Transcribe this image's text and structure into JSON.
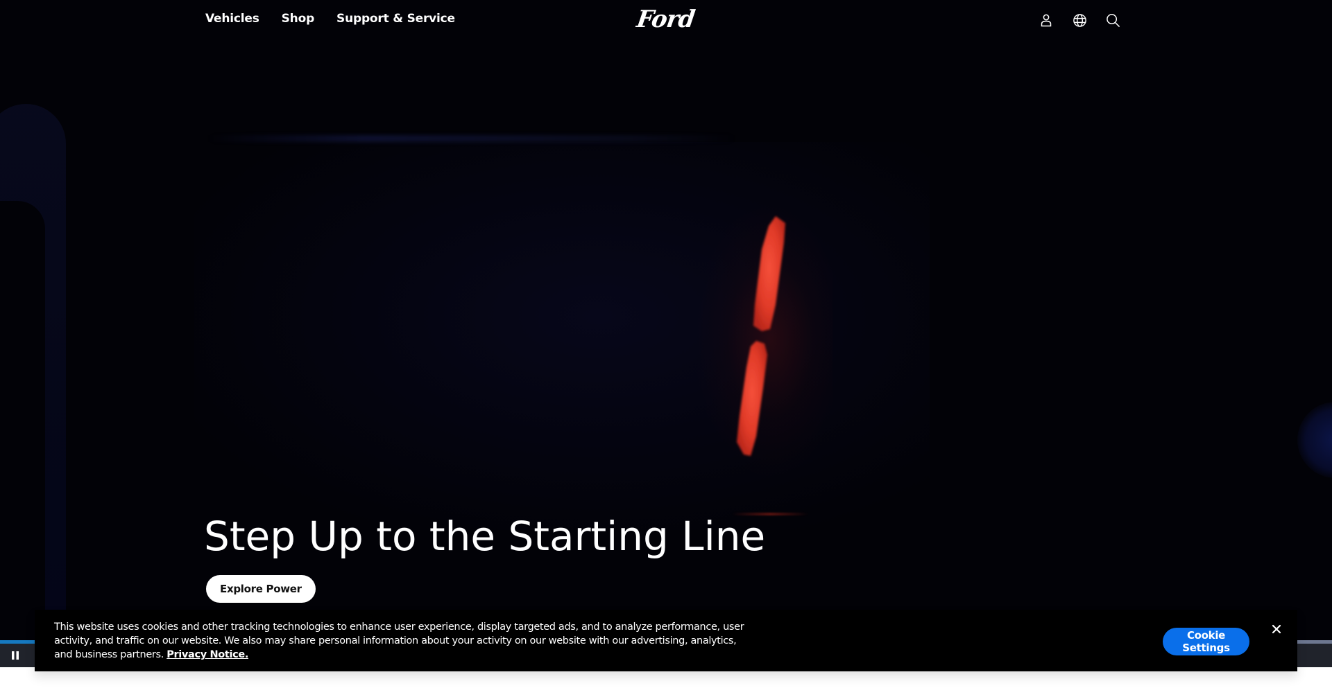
{
  "header": {
    "nav": [
      {
        "label": "Vehicles"
      },
      {
        "label": "Shop"
      },
      {
        "label": "Support & Service"
      }
    ],
    "logo_text": "Ford",
    "icons": [
      "account-icon",
      "globe-icon",
      "search-icon"
    ]
  },
  "hero": {
    "title": "Step Up to the Starting Line",
    "cta_label": "Explore Power"
  },
  "video": {
    "state": "playing",
    "control_icon": "pause-icon",
    "progress_percent": 3
  },
  "cookie_banner": {
    "text": "This website uses cookies and other tracking technologies to enhance user experience, display targeted ads, and to analyze performance, user activity, and traffic on our website. We also may share personal information about your activity on our website with our advertising, analytics, and business partners.",
    "link_label": "Privacy Notice.",
    "settings_label": "Cookie Settings",
    "close_icon": "close-icon"
  },
  "colors": {
    "accent_blue": "#0a6fea",
    "progress_fill": "#1679c0",
    "tail_light_red": "#e53a28"
  }
}
